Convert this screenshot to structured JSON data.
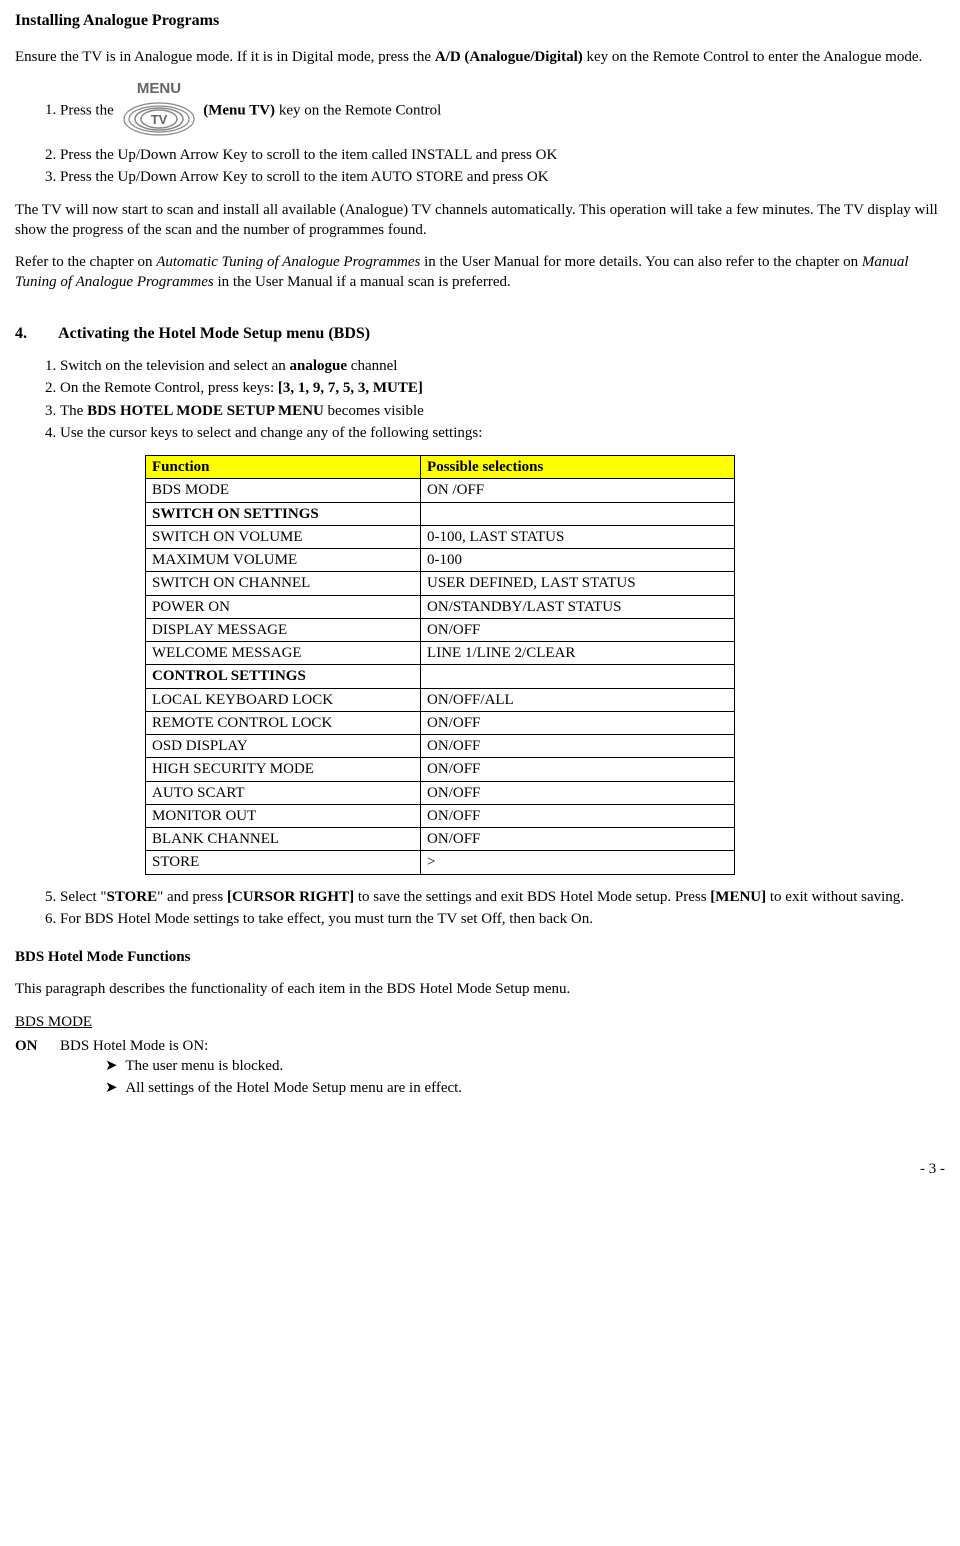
{
  "heading1": "Installing Analogue Programs",
  "para1_a": "Ensure the TV is in Analogue mode. If it is in Digital mode, press the ",
  "para1_b": "A/D (Analogue/Digital)",
  "para1_c": " key on the Remote Control to enter the Analogue mode.",
  "button_top": "MENU",
  "button_label": "TV",
  "steps1": {
    "1a": "Press the ",
    "1b": "(Menu TV)",
    "1c": " key on the Remote Control",
    "2": "Press the Up/Down Arrow Key to scroll to the item called INSTALL and press OK",
    "3": "Press the Up/Down Arrow Key to scroll to the item AUTO STORE and press OK"
  },
  "para2": "The TV will now start to scan and install all available (Analogue) TV channels automatically. This operation will take a few minutes. The TV display will show the progress of the scan and the number of programmes found.",
  "para3_a": "Refer to the chapter on ",
  "para3_b": "Automatic Tuning of Analogue Programmes",
  "para3_c": " in the User Manual for more details. You can also refer to the chapter on ",
  "para3_d": "Manual Tuning of Analogue Programmes",
  "para3_e": " in the User Manual if a manual scan is preferred.",
  "section4_num": "4.",
  "section4_title": "Activating the Hotel Mode Setup menu (BDS)",
  "steps2": {
    "1a": "Switch on the television and select an ",
    "1b": "analogue",
    "1c": " channel",
    "2a": "On the Remote Control, press keys: ",
    "2b": "[3, 1, 9, 7, 5, 3, MUTE]",
    "3a": "The ",
    "3b": "BDS HOTEL MODE SETUP MENU",
    "3c": " becomes visible",
    "4": "Use the cursor keys to select and change any of the following settings:"
  },
  "table": {
    "header": [
      "Function",
      "Possible selections"
    ],
    "rows": [
      [
        "BDS MODE",
        "ON /OFF",
        false
      ],
      [
        "SWITCH ON SETTINGS",
        "",
        true
      ],
      [
        "SWITCH ON VOLUME",
        "0-100, LAST STATUS",
        false
      ],
      [
        "MAXIMUM VOLUME",
        "0-100",
        false
      ],
      [
        "SWITCH ON CHANNEL",
        "USER DEFINED, LAST STATUS",
        false
      ],
      [
        "POWER ON",
        "ON/STANDBY/LAST STATUS",
        false
      ],
      [
        "DISPLAY MESSAGE",
        "ON/OFF",
        false
      ],
      [
        "WELCOME MESSAGE",
        "LINE 1/LINE 2/CLEAR",
        false
      ],
      [
        "CONTROL SETTINGS",
        "",
        true
      ],
      [
        "LOCAL KEYBOARD LOCK",
        "ON/OFF/ALL",
        false
      ],
      [
        "REMOTE CONTROL LOCK",
        "ON/OFF",
        false
      ],
      [
        "OSD DISPLAY",
        "ON/OFF",
        false
      ],
      [
        "HIGH SECURITY MODE",
        "ON/OFF",
        false
      ],
      [
        "AUTO SCART",
        "ON/OFF",
        false
      ],
      [
        "MONITOR OUT",
        "ON/OFF",
        false
      ],
      [
        "BLANK CHANNEL",
        "ON/OFF",
        false
      ],
      [
        "STORE",
        ">",
        false
      ]
    ]
  },
  "step5_a": "Select \"",
  "step5_b": "STORE",
  "step5_c": "\" and press ",
  "step5_d": "[CURSOR RIGHT]",
  "step5_e": " to save the settings and exit BDS Hotel Mode setup. Press ",
  "step5_f": "[MENU]",
  "step5_g": " to exit without saving.",
  "step6": "For BDS Hotel Mode settings to take effect, you must turn the TV set Off, then back On.",
  "subheading": "BDS Hotel Mode Functions",
  "para4": "This paragraph describes the functionality of each item in the BDS Hotel Mode Setup menu.",
  "bds_mode_label": "BDS MODE",
  "bds_on_label": "ON",
  "bds_on_text": "BDS Hotel Mode is ON:",
  "bds_bullets": [
    "The user menu is blocked.",
    "All settings of the Hotel Mode Setup menu are in effect."
  ],
  "pagenum": "- 3 -"
}
